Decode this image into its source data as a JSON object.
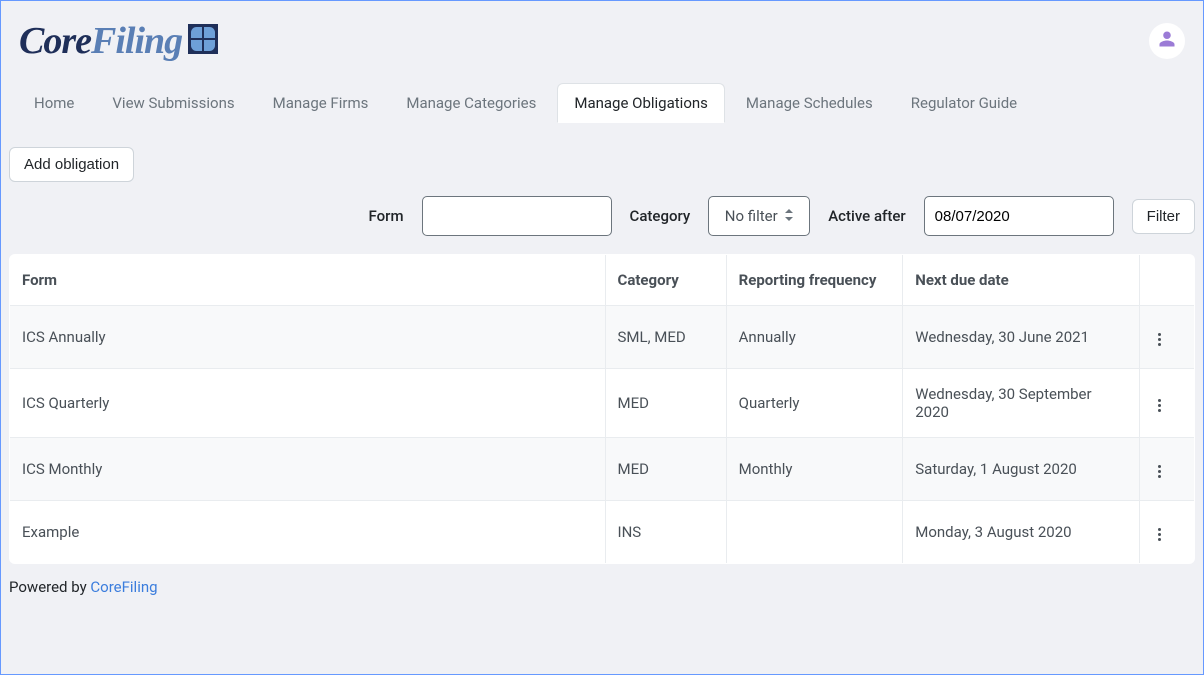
{
  "brand": {
    "core": "Core",
    "filing": "Filing"
  },
  "nav": {
    "items": [
      {
        "label": "Home"
      },
      {
        "label": "View Submissions"
      },
      {
        "label": "Manage Firms"
      },
      {
        "label": "Manage Categories"
      },
      {
        "label": "Manage Obligations",
        "active": true
      },
      {
        "label": "Manage Schedules"
      },
      {
        "label": "Regulator Guide"
      }
    ]
  },
  "actions": {
    "add_obligation": "Add obligation",
    "filter": "Filter"
  },
  "filters": {
    "form_label": "Form",
    "form_value": "",
    "category_label": "Category",
    "category_value": "No filter",
    "active_after_label": "Active after",
    "active_after_value": "08/07/2020"
  },
  "table": {
    "columns": {
      "form": "Form",
      "category": "Category",
      "frequency": "Reporting frequency",
      "due": "Next due date"
    },
    "rows": [
      {
        "form": "ICS Annually",
        "category": "SML, MED",
        "frequency": "Annually",
        "due": "Wednesday, 30 June 2021"
      },
      {
        "form": "ICS Quarterly",
        "category": "MED",
        "frequency": "Quarterly",
        "due": "Wednesday, 30 September 2020"
      },
      {
        "form": "ICS Monthly",
        "category": "MED",
        "frequency": "Monthly",
        "due": "Saturday, 1 August 2020"
      },
      {
        "form": "Example",
        "category": "INS",
        "frequency": "",
        "due": "Monday, 3 August 2020"
      }
    ]
  },
  "footer": {
    "powered_by": "Powered by ",
    "link_text": "CoreFiling"
  }
}
